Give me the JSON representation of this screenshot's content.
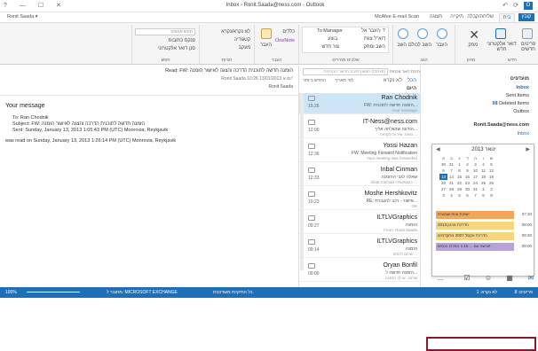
{
  "titlebar": {
    "title": "Inbox - Ronit.Saada@ness.com - Outlook",
    "controls": [
      "?",
      "—",
      "☐",
      "✕"
    ]
  },
  "tabs": [
    {
      "label": "קובץ",
      "active": false
    },
    {
      "label": "בית",
      "active": true
    },
    {
      "label": "שליחה/קבלה",
      "active": false
    },
    {
      "label": "תיקייה",
      "active": false
    },
    {
      "label": "תצוגה",
      "active": false
    },
    {
      "label": "McAfee E-mail Scan",
      "active": false
    }
  ],
  "ribbon": {
    "new_email": "דואר אלקטרוני חדש",
    "new_items": "פריטים חדשים",
    "delete": "מחק",
    "reply": "השב",
    "reply_all": "השב לכולם",
    "forward": "העבר",
    "quick_steps": [
      "העבר אל: ?",
      "To Manager",
      "דוא\"ל צוות",
      "בוצע",
      "השב ומחק",
      "צור חדש"
    ],
    "move": "העבר",
    "rules": "כללים",
    "onenote": "OneNote",
    "tags": [
      "לא נקרא/נקרא",
      "קטגוריה",
      "מעקב"
    ],
    "find_people": "חפש אנשים",
    "address_book": "פנקס כתובות",
    "filter_email": "סנן דואר אלקטרוני",
    "groups": [
      "חדש",
      "מחק",
      "הגב",
      "שלבים מהירים",
      "העבר",
      "תגיות",
      "חפש"
    ]
  },
  "reading": {
    "header_from": "Ronit Saada",
    "header_subject": "Read: FW: הזמנה חדשה לתוכנית הדרכה והצגה לאישור הזמנה",
    "header_meta": "Ronit Saada  10:26 13/01/2013 יום א'",
    "title": "Your message",
    "to": "To: Ran Chodnik",
    "subject": "Subject: FW: הזמנה חדשה לתוכנית הדרכה והצגה לאישור הזמנה",
    "sent": "Sent: Sunday, January 13, 2013 1:05:43 PM (UTC) Monrovia, Reykjavik",
    "read": "was read on Sunday, January 13, 2013 1:26:14 PM (UTC) Monrovia, Reykjavik"
  },
  "msglist": {
    "search_placeholder": "חפש בתיבת הדואר הנוכחית (Ctrl+E)",
    "scope": "תיבת דואר נוכחית",
    "filter_all": "הכל",
    "filter_unread": "לא נקרא",
    "sort": "לפי תאריך",
    "sort_dir": "החדש ביותר",
    "group_today": "היום",
    "items": [
      {
        "sender": "Ran Chodnik",
        "subject": "FW: הזמנה חדשה לתוכנית...",
        "preview": "Your message",
        "time": "15:26",
        "selected": true
      },
      {
        "sender": "IT-Ness@ness.com",
        "subject": "הודעה שנשלחה אליך...",
        "preview": "מאת: שירות לקוחות ...",
        "time": "12:00",
        "selected": false
      },
      {
        "sender": "Yossi Hazan",
        "subject": "FW: Meeting Forward Notification",
        "preview": "Your meeting was forwarded",
        "time": "12:36",
        "selected": false
      },
      {
        "sender": "Inbal Cinman",
        "subject": "שאלה לגבי ההזמנה",
        "preview": "Inbal Cinman <Human> ...",
        "time": "12:33",
        "selected": false
      },
      {
        "sender": "Moshe Hershkovitz",
        "subject": "RE: אישור - רכב להעברת...",
        "preview": "OK",
        "time": "10:23",
        "selected": false
      },
      {
        "sender": "ILTLVGraphics",
        "subject": "הזמנה",
        "preview": "From: Ronit Saada",
        "time": "09:27",
        "selected": false
      },
      {
        "sender": "ILTLVGraphics",
        "subject": "הזמנה",
        "preview": "שלום לכולם ...",
        "time": "09:14",
        "selected": false
      },
      {
        "sender": "Oryan Bonfil",
        "subject": "הזמנה חדשה ל...",
        "preview": "שלום, יש לך הזמנה",
        "time": "09:00",
        "selected": false
      }
    ]
  },
  "folders": {
    "favorites": "מועדפים",
    "inbox": "Inbox",
    "sent": "Sent Items",
    "deleted": "Deleted Items",
    "deleted_count": "98",
    "outbox": "Outbox",
    "account": "Ronit.Saada@ness.com",
    "inbox2": "Inbox"
  },
  "calendar": {
    "month": "ינואר 2013",
    "weekdays": [
      "א",
      "ב",
      "ג",
      "ד",
      "ה",
      "ו",
      "ש"
    ],
    "weeks": [
      [
        "30",
        "31",
        "1",
        "2",
        "3",
        "4",
        "5"
      ],
      [
        "6",
        "7",
        "8",
        "9",
        "10",
        "11",
        "12"
      ],
      [
        "13",
        "14",
        "15",
        "16",
        "17",
        "18",
        "19"
      ],
      [
        "20",
        "21",
        "22",
        "23",
        "24",
        "25",
        "26"
      ],
      [
        "27",
        "28",
        "29",
        "30",
        "31",
        "1",
        "2"
      ],
      [
        "3",
        "4",
        "5",
        "6",
        "7",
        "8",
        "9"
      ]
    ],
    "today": "13",
    "appointments": [
      {
        "time": "07:30",
        "title": "ישיבת צוות שבועית",
        "color": "#f3a55b"
      },
      {
        "time": "08:00",
        "title": "הדרכת ארגון 2013",
        "color": "#f7d57f"
      },
      {
        "time": "08:30",
        "title": "הדרכת אקסל 2007 מתקדמים",
        "color": "#f7d57f"
      },
      {
        "time": "09:00",
        "title": "פגישה עם ... 1:15 במרכז כנסים",
        "color": "#b8a3d8"
      }
    ]
  },
  "navbar": {
    "mail": "✉",
    "calendar": "▦",
    "people": "☺",
    "tasks": "☑",
    "more": "..."
  },
  "statusbar": {
    "left": "פריטים: 8",
    "unread": "לא נקרא: 1",
    "center": "כל התיקיות מעודכנות.",
    "connection": "מחובר ל: MICROSOFT EXCHANGE",
    "zoom": "100%"
  },
  "colors": {
    "accent": "#1f6fb8",
    "selected": "#cde6f7",
    "nav_highlight": "#8b1a2b"
  }
}
